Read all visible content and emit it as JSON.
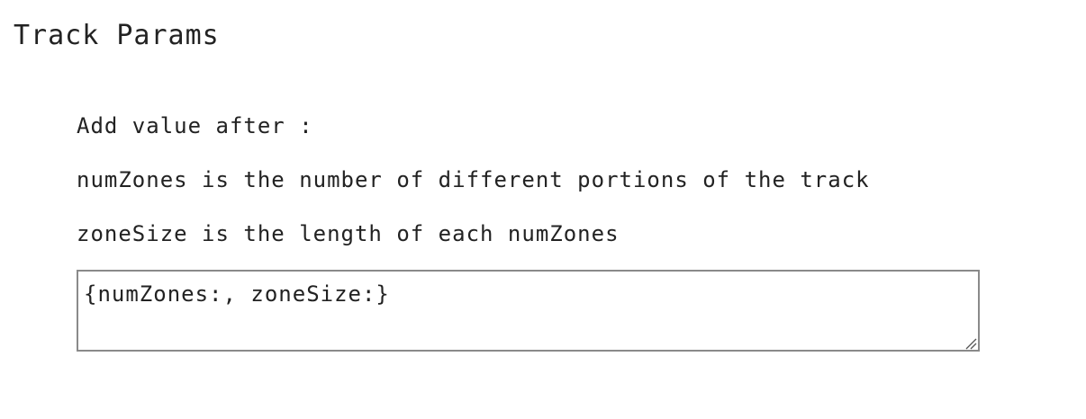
{
  "page": {
    "title": "Track Params"
  },
  "instructions": {
    "line1": "Add value after :",
    "line2": "numZones is the number of different portions of the track",
    "line3": "zoneSize is the length of each numZones"
  },
  "params_input": {
    "value": "{numZones:, zoneSize:}",
    "resize_icon": "resize-grip-icon"
  }
}
